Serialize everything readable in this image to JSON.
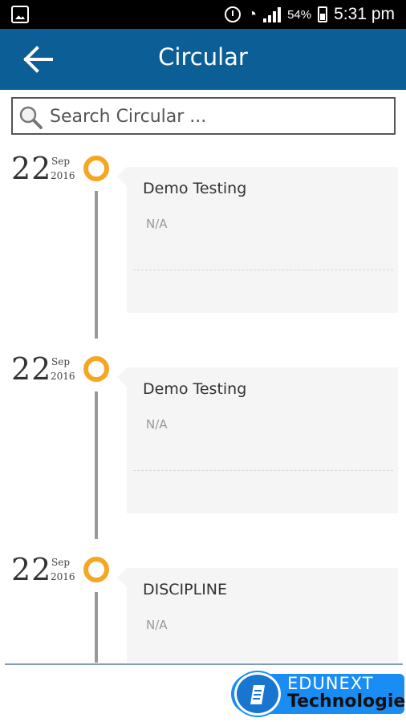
{
  "status_bar": {
    "battery_pct": "54%",
    "time": "5:31 pm"
  },
  "app_bar": {
    "title": "Circular",
    "back_icon": "arrow-left-icon"
  },
  "search": {
    "placeholder": "Search Circular ...",
    "icon": "search-icon"
  },
  "circulars": [
    {
      "day": "22",
      "month": "Sep",
      "year": "2016",
      "title": "Demo Testing",
      "body": "N/A"
    },
    {
      "day": "22",
      "month": "Sep",
      "year": "2016",
      "title": "Demo Testing",
      "body": "N/A"
    },
    {
      "day": "22",
      "month": "Sep",
      "year": "2016",
      "title": "DISCIPLINE",
      "body": "N/A"
    }
  ],
  "footer": {
    "brand_name": "EDUNEXT",
    "brand_sub": "Technologies"
  },
  "colors": {
    "app_bar": "#0c5e96",
    "timeline_dot": "#f5a623",
    "brand": "#1a8df5"
  }
}
